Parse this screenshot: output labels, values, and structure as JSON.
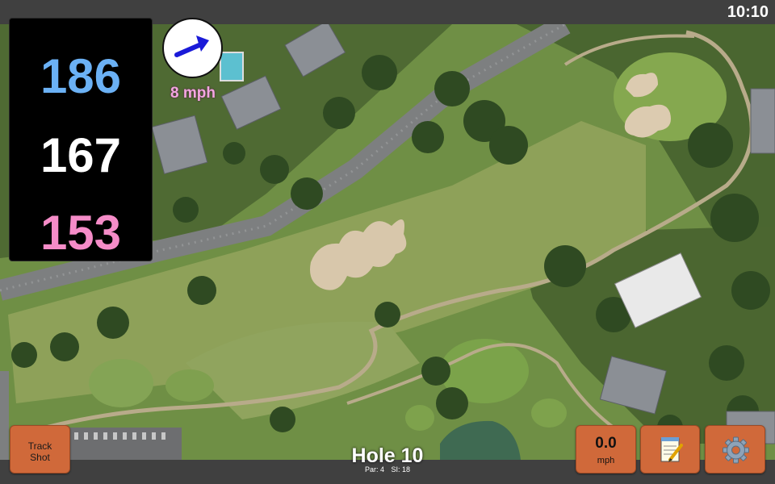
{
  "status": {
    "clock": "10:10"
  },
  "distances": {
    "back": "186",
    "middle": "167",
    "front": "153"
  },
  "wind": {
    "speed": "8 mph",
    "direction_icon": "arrow-icon",
    "colors": {
      "arrow": "#1a1ad8",
      "dial": "#ffffff"
    }
  },
  "hole": {
    "title": "Hole 10",
    "par": "Par: 4",
    "si": "SI: 18"
  },
  "buttons": {
    "track_shot_line1": "Track",
    "track_shot_line2": "Shot",
    "speed_value": "0.0",
    "speed_unit": "mph",
    "notes_icon": "notepad-icon",
    "settings_icon": "gear-icon"
  },
  "colors": {
    "back": "#6bb1f5",
    "middle": "#ffffff",
    "front": "#f58cc8",
    "button": "#d0693a",
    "wind_text": "#f3a6e0"
  }
}
